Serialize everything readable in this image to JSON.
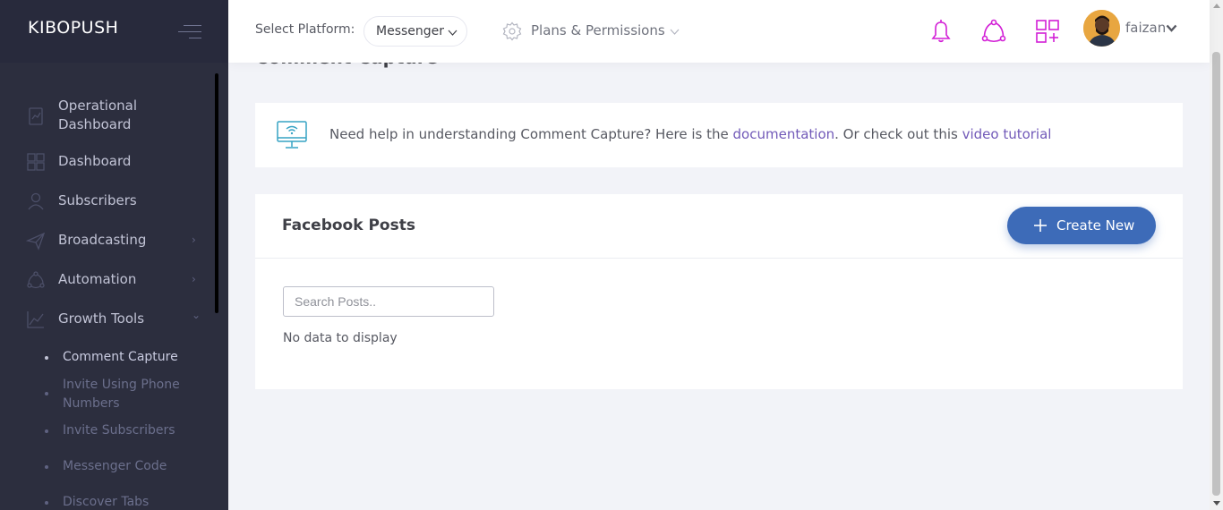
{
  "brand": {
    "name": "KIBOPUSH"
  },
  "sidebar": {
    "items": [
      {
        "label": "Operational Dashboard",
        "icon": "chart-box-icon"
      },
      {
        "label": "Dashboard",
        "icon": "grid-icon"
      },
      {
        "label": "Subscribers",
        "icon": "user-icon"
      },
      {
        "label": "Broadcasting",
        "icon": "paper-plane-icon",
        "arrow": "›"
      },
      {
        "label": "Automation",
        "icon": "network-icon",
        "arrow": "›"
      },
      {
        "label": "Growth Tools",
        "icon": "line-chart-icon",
        "arrow": "⌄"
      }
    ],
    "subitems": [
      {
        "label": "Comment Capture",
        "active": true
      },
      {
        "label": "Invite Using Phone Numbers"
      },
      {
        "label": "Invite Subscribers"
      },
      {
        "label": "Messenger Code"
      },
      {
        "label": "Discover Tabs"
      }
    ]
  },
  "topbar": {
    "platform_label": "Select Platform:",
    "platform_value": "Messenger",
    "plans_label": "Plans & Permissions",
    "user_name": "faizan",
    "icons": [
      "bell-icon",
      "share-network-icon",
      "apps-add-icon"
    ]
  },
  "page": {
    "title": "Comment Capture",
    "help": {
      "prefix": "Need help in understanding Comment Capture? Here is the ",
      "doc_link": "documentation",
      "middle": ". Or check out this ",
      "video_link": "video tutorial"
    },
    "posts": {
      "title": "Facebook Posts",
      "create_label": "Create New",
      "search_placeholder": "Search Posts..",
      "empty_text": "No data to display"
    }
  },
  "colors": {
    "sidebar_bg": "#2c2e3e",
    "accent_magenta": "#d21fd6",
    "link": "#7159b8",
    "button": "#3d6bb8",
    "help_icon": "#36a3c4"
  }
}
